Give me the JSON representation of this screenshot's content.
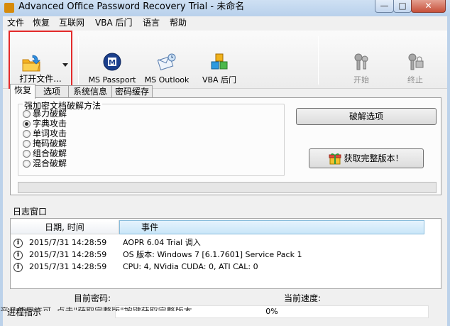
{
  "window": {
    "title": "Advanced Office Password Recovery Trial - 未命名",
    "minimize": "—",
    "maximize": "□",
    "close": "✕"
  },
  "menu": [
    "文件",
    "恢复",
    "互联网",
    "VBA 后门",
    "语言",
    "帮助"
  ],
  "toolbar": {
    "open_label": "打开文件...",
    "ms_passport": "MS Passport",
    "ms_outlook": "MS Outlook",
    "vba_backdoor": "VBA 后门",
    "start": "开始",
    "stop": "终止"
  },
  "tabs": [
    "恢复",
    "选项",
    "系统信息",
    "密码缓存"
  ],
  "recovery": {
    "group_title": "强加密文档破解方法",
    "methods": [
      "暴力破解",
      "字典攻击",
      "单词攻击",
      "掩码破解",
      "组合破解",
      "混合破解"
    ],
    "selected_index": 1,
    "crack_options_button": "破解选项",
    "get_full_button": "获取完整版本！"
  },
  "log": {
    "label": "日志窗口",
    "columns": [
      "日期, 时间",
      "事件"
    ],
    "rows": [
      {
        "date": "2015/7/31 14:28:59",
        "event": "AOPR 6.04 Trial 调入"
      },
      {
        "date": "2015/7/31 14:28:59",
        "event": "OS 版本: Windows 7 [6.1.7601] Service Pack 1"
      },
      {
        "date": "2015/7/31 14:28:59",
        "event": "CPU: 4, NVidia CUDA: 0, ATI CAL: 0"
      }
    ]
  },
  "status": {
    "current_password_label": "目前密码:",
    "current_speed_label": "当前速度:",
    "progress_label": "进程指示",
    "progress_value": "0%",
    "progress_fraction": 0,
    "footer_text": "产品使用许可. 点击\"获取完整版\"按键获取完整版本"
  },
  "colors": {
    "highlight_border": "#e32b2b",
    "header_selected": "#c9e6f8"
  }
}
